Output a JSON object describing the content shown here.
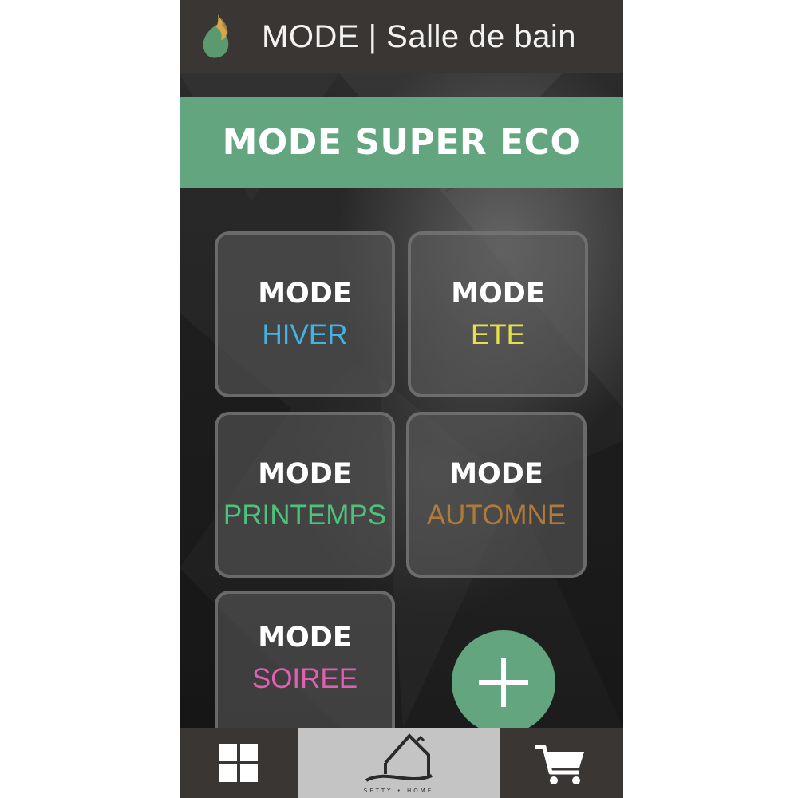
{
  "header": {
    "title": "MODE | Salle de bain",
    "logo_icon": "flame-leaf-logo"
  },
  "banner": {
    "label": "MODE SUPER ECO",
    "color": "#62a57f"
  },
  "tiles": [
    {
      "line1": "MODE",
      "line2": "HIVER",
      "color": "#3fb4e5"
    },
    {
      "line1": "MODE",
      "line2": "ETE",
      "color": "#e8e04a"
    },
    {
      "line1": "MODE",
      "line2": "PRINTEMPS",
      "color": "#4cc27a"
    },
    {
      "line1": "MODE",
      "line2": "AUTOMNE",
      "color": "#b07a3a"
    },
    {
      "line1": "MODE",
      "line2": "SOIREE",
      "color": "#e060b0"
    }
  ],
  "fab": {
    "icon": "plus-icon",
    "color": "#62a57f"
  },
  "bottom_nav": {
    "items": [
      {
        "icon": "grid-icon"
      },
      {
        "icon": "home-logo-icon",
        "caption": "SETTY • HOME"
      },
      {
        "icon": "cart-icon"
      }
    ]
  }
}
